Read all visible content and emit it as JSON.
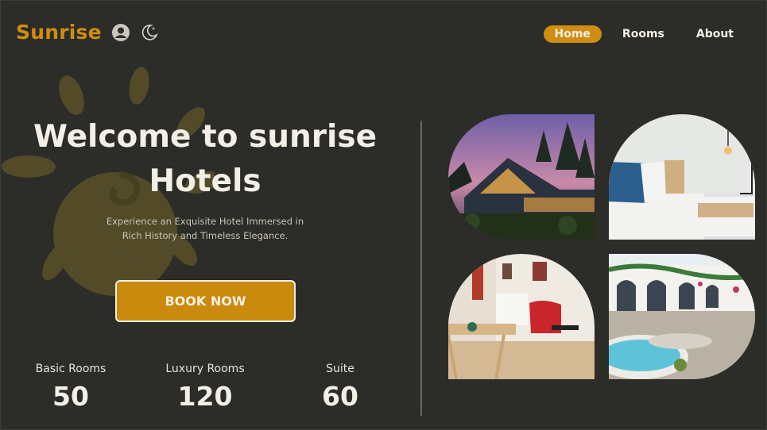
{
  "header": {
    "brand": "Sunrise",
    "user_icon": "user-circle-icon",
    "theme_icon": "moon-icon",
    "nav": [
      {
        "label": "Home",
        "active": true
      },
      {
        "label": "Rooms",
        "active": false
      },
      {
        "label": "About",
        "active": false
      }
    ]
  },
  "hero": {
    "title_line1": "Welcome to sunrise",
    "title_line2": "Hotels",
    "subtitle_line1": "Experience an Exquisite Hotel Immersed in",
    "subtitle_line2": "Rich History and Timeless Elegance.",
    "cta": "BOOK NOW"
  },
  "stats": [
    {
      "label": "Basic Rooms",
      "value": "50"
    },
    {
      "label": "Luxury Rooms",
      "value": "120"
    },
    {
      "label": "Suite",
      "value": "60"
    }
  ],
  "gallery": [
    {
      "name": "hotel-exterior-dusk"
    },
    {
      "name": "bedroom-with-lamp"
    },
    {
      "name": "living-room-red-chair"
    },
    {
      "name": "courtyard-pool"
    }
  ],
  "colors": {
    "background": "#2c2c28",
    "accent": "#cf8d12",
    "text": "#f3efe6"
  }
}
